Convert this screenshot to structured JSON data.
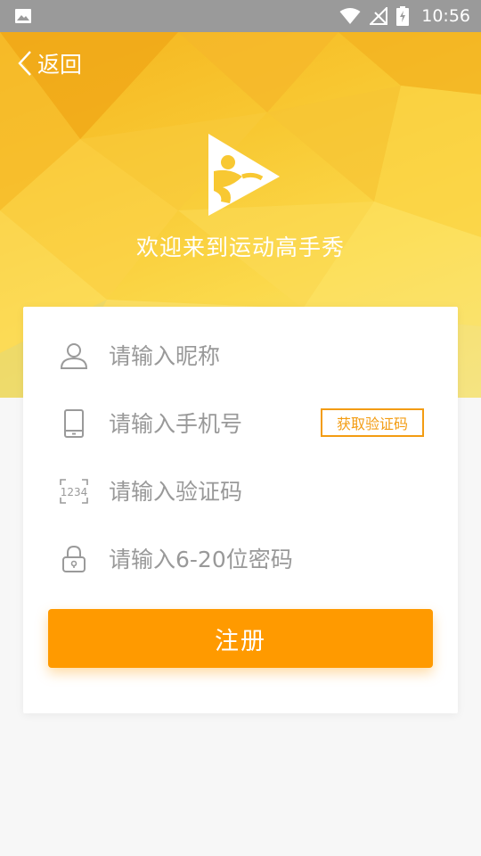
{
  "status_bar": {
    "time": "10:56"
  },
  "header": {
    "back_label": "返回",
    "welcome": "欢迎来到运动高手秀"
  },
  "form": {
    "nickname_placeholder": "请输入昵称",
    "phone_placeholder": "请输入手机号",
    "get_code_label": "获取验证码",
    "code_placeholder": "请输入验证码",
    "password_placeholder": "请输入6-20位密码",
    "register_label": "注册"
  },
  "icons": {
    "nickname": "user-icon",
    "phone": "phone-icon",
    "code": "code-1234-icon",
    "password": "lock-icon",
    "back": "chevron-left-icon",
    "logo": "sport-logo-icon"
  },
  "colors": {
    "accent": "#ff9a00",
    "code_button": "#f39c12",
    "hero": "#f8c832"
  }
}
